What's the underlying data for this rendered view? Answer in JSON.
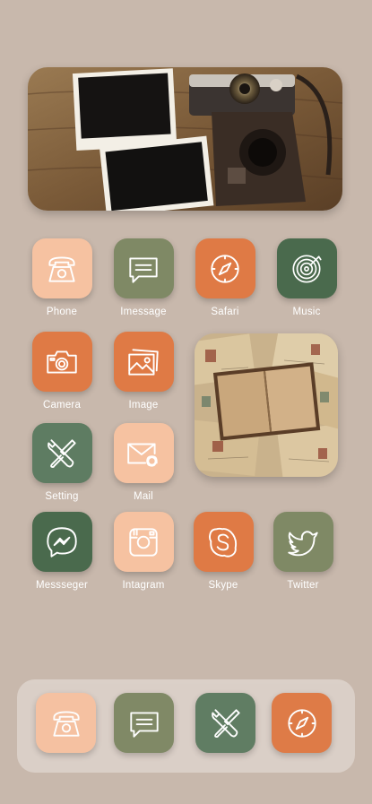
{
  "colors": {
    "background": "#c8b8ac",
    "peach": "#f6c2a1",
    "olive": "#7f8965",
    "orange": "#df7a45",
    "dark_green": "#4a6a4d",
    "sage_green": "#5e7c62",
    "dock": "#dbd0c8"
  },
  "widgets": {
    "top_photo": "vintage camera and polaroid frames photo",
    "postcard": "open book on vintage postcards photo"
  },
  "apps": [
    {
      "label": "Phone",
      "icon": "phone-icon",
      "color": "peach"
    },
    {
      "label": "Imessage",
      "icon": "message-icon",
      "color": "olive"
    },
    {
      "label": "Safari",
      "icon": "compass-icon",
      "color": "orange"
    },
    {
      "label": "Music",
      "icon": "music-disc-icon",
      "color": "dark_green"
    },
    {
      "label": "Camera",
      "icon": "camera-icon",
      "color": "orange"
    },
    {
      "label": "Image",
      "icon": "image-icon",
      "color": "orange"
    },
    {
      "label": "Setting",
      "icon": "tools-icon",
      "color": "sage_green"
    },
    {
      "label": "Mail",
      "icon": "mail-icon",
      "color": "peach"
    },
    {
      "label": "Messseger",
      "icon": "messenger-icon",
      "color": "dark_green"
    },
    {
      "label": "Intagram",
      "icon": "instagram-icon",
      "color": "peach"
    },
    {
      "label": "Skype",
      "icon": "skype-icon",
      "color": "orange"
    },
    {
      "label": "Twitter",
      "icon": "twitter-icon",
      "color": "olive"
    }
  ],
  "dock": [
    {
      "icon": "phone-icon",
      "color": "peach"
    },
    {
      "icon": "message-icon",
      "color": "olive"
    },
    {
      "icon": "tools-icon",
      "color": "sage_green"
    },
    {
      "icon": "compass-icon",
      "color": "orange"
    }
  ]
}
